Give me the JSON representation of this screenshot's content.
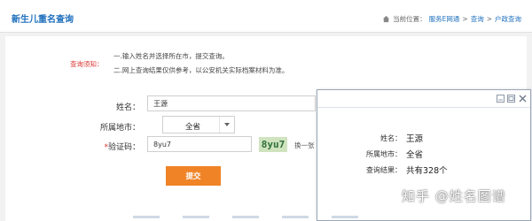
{
  "header": {
    "title": "新生儿重名查询",
    "breadcrumb": {
      "prefix": "当前位置：",
      "items": [
        "服务E网通",
        "查询",
        "户政查询"
      ],
      "separator": ">"
    }
  },
  "notice": {
    "label": "查询须知：",
    "lines": [
      "一.输入姓名并选择所在市，提交查询。",
      "二.网上查询结果仅供参考，以公安机关实际档案材料为准。"
    ]
  },
  "form": {
    "name_label": "姓名：",
    "name_value": "王源",
    "city_label": "所属地市：",
    "city_selected": "全省",
    "code_label": "验证码：",
    "code_required_mark": "*",
    "code_value": "8yu7",
    "captcha_text": "8yu7",
    "refresh_label": "换一张",
    "submit_label": "提交"
  },
  "result_popup": {
    "name_label": "姓名：",
    "name_value": "王源",
    "city_label": "所属地市：",
    "city_value": "全省",
    "result_label": "查询结果：",
    "result_value": "共有328个"
  },
  "watermark": "知乎 @姓名图谱",
  "colors": {
    "link_blue": "#1d6fbd",
    "notice_red": "#d9332d",
    "submit_orange": "#f08326",
    "captcha_bg": "#cfe3bf"
  }
}
